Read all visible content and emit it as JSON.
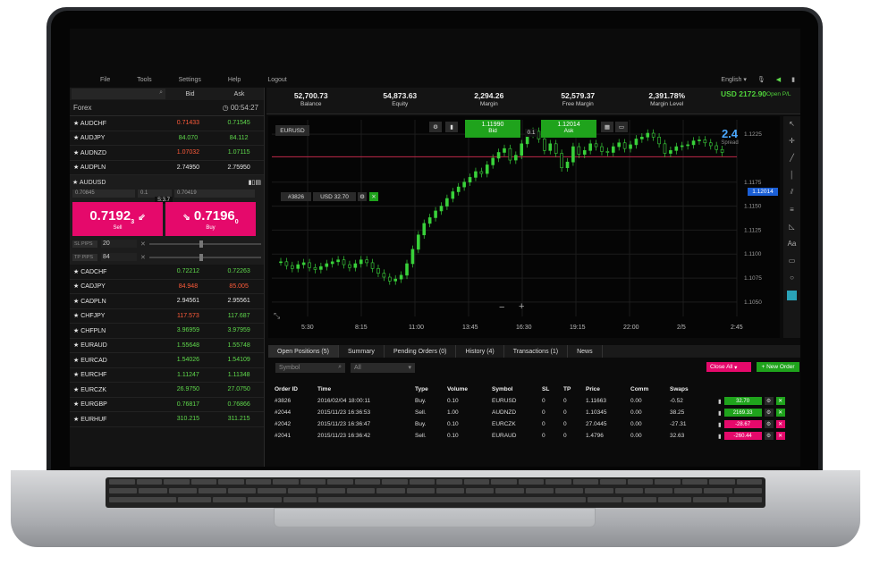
{
  "menu": {
    "items": [
      "File",
      "Tools",
      "Settings",
      "Help",
      "Logout"
    ],
    "language": "English"
  },
  "watchlist": {
    "bid_label": "Bid",
    "ask_label": "Ask",
    "group": "Forex",
    "clock": "00:54:27",
    "rows_top": [
      {
        "sym": "AUDCHF",
        "bid": "0.71433",
        "ask": "0.71545",
        "bc": "red",
        "ac": "green"
      },
      {
        "sym": "AUDJPY",
        "bid": "84.070",
        "ask": "84.112",
        "bc": "green",
        "ac": "green"
      },
      {
        "sym": "AUDNZD",
        "bid": "1.07032",
        "ask": "1.07115",
        "bc": "red",
        "ac": "green"
      },
      {
        "sym": "AUDPLN",
        "bid": "2.74950",
        "ask": "2.75950",
        "bc": "white",
        "ac": "white"
      }
    ],
    "expanded": {
      "sym": "AUDUSD",
      "field1": "0.70845",
      "field2": "0.1",
      "field3": "0.70419",
      "sell_price": "0.7192",
      "sell_sup": "3",
      "sell_label": "Sell",
      "buy_price": "0.7196",
      "buy_sup": "0",
      "buy_label": "Buy",
      "spread": "S:3.7",
      "sl_label": "SL PIPS",
      "sl_value": "20",
      "tp_label": "TP PIPS",
      "tp_value": "84"
    },
    "rows_bottom": [
      {
        "sym": "CADCHF",
        "bid": "0.72212",
        "ask": "0.72263",
        "bc": "green",
        "ac": "green"
      },
      {
        "sym": "CADJPY",
        "bid": "84.948",
        "ask": "85.005",
        "bc": "red",
        "ac": "red"
      },
      {
        "sym": "CADPLN",
        "bid": "2.94561",
        "ask": "2.95561",
        "bc": "white",
        "ac": "white"
      },
      {
        "sym": "CHFJPY",
        "bid": "117.573",
        "ask": "117.687",
        "bc": "red",
        "ac": "green"
      },
      {
        "sym": "CHFPLN",
        "bid": "3.96959",
        "ask": "3.97959",
        "bc": "green",
        "ac": "green"
      },
      {
        "sym": "EURAUD",
        "bid": "1.55648",
        "ask": "1.55748",
        "bc": "green",
        "ac": "green"
      },
      {
        "sym": "EURCAD",
        "bid": "1.54026",
        "ask": "1.54109",
        "bc": "green",
        "ac": "green"
      },
      {
        "sym": "EURCHF",
        "bid": "1.11247",
        "ask": "1.11348",
        "bc": "green",
        "ac": "green"
      },
      {
        "sym": "EURCZK",
        "bid": "26.9750",
        "ask": "27.0750",
        "bc": "green",
        "ac": "green"
      },
      {
        "sym": "EURGBP",
        "bid": "0.76817",
        "ask": "0.76866",
        "bc": "green",
        "ac": "green"
      },
      {
        "sym": "EURHUF",
        "bid": "310.215",
        "ask": "311.215",
        "bc": "green",
        "ac": "green"
      }
    ]
  },
  "stats": [
    {
      "value": "52,700.73",
      "label": "Balance"
    },
    {
      "value": "54,873.63",
      "label": "Equity"
    },
    {
      "value": "2,294.26",
      "label": "Margin"
    },
    {
      "value": "52,579.37",
      "label": "Free Margin"
    },
    {
      "value": "2,391.78%",
      "label": "Margin Level"
    },
    {
      "value": "USD 2172.90",
      "label": "Open P/L"
    }
  ],
  "chart": {
    "symbol": "EURUSD",
    "bid": "1.11990",
    "bid_label": "Bid",
    "ask": "1.12014",
    "ask_label": "Ask",
    "spread_mid": "0.1",
    "spread": "2.4",
    "spread_label": "Spread",
    "current": "1.12014",
    "order_tag": "#3826",
    "order_value": "USD 32.70",
    "y_ticks": [
      "1.1225",
      "1.1175",
      "1.1150",
      "1.1125",
      "1.1100",
      "1.1075",
      "1.1050"
    ],
    "x_ticks": [
      "5:30",
      "8:15",
      "11:00",
      "13:45",
      "16:30",
      "19:15",
      "22:00",
      "2/5",
      "2:45"
    ]
  },
  "chart_data": {
    "type": "candlestick",
    "ylim": [
      1.1035,
      1.124
    ],
    "close": [
      1.1092,
      1.1088,
      1.1085,
      1.1089,
      1.1091,
      1.1086,
      1.1084,
      1.1087,
      1.109,
      1.1092,
      1.1094,
      1.1089,
      1.1086,
      1.109,
      1.1094,
      1.1091,
      1.1085,
      1.108,
      1.1076,
      1.1072,
      1.1074,
      1.1078,
      1.109,
      1.1105,
      1.112,
      1.1132,
      1.1138,
      1.1145,
      1.115,
      1.1158,
      1.1165,
      1.117,
      1.1175,
      1.118,
      1.1186,
      1.1184,
      1.1193,
      1.12,
      1.1206,
      1.121,
      1.1198,
      1.1203,
      1.1215,
      1.1225,
      1.1228,
      1.122,
      1.1208,
      1.1215,
      1.1205,
      1.119,
      1.1196,
      1.1212,
      1.1204,
      1.1208,
      1.1215,
      1.1212,
      1.1207,
      1.1206,
      1.1212,
      1.1216,
      1.121,
      1.1214,
      1.122,
      1.1222,
      1.1226,
      1.1222,
      1.1215,
      1.1205,
      1.1208,
      1.1212,
      1.1213,
      1.1214,
      1.1218,
      1.1219,
      1.1216,
      1.1213,
      1.1209,
      1.1206
    ]
  },
  "bottom": {
    "tabs": [
      "Open Positions (5)",
      "Summary",
      "Pending Orders (0)",
      "History (4)",
      "Transactions (1)",
      "News"
    ],
    "symbol_placeholder": "Symbol",
    "all_placeholder": "All",
    "close_all": "Close All",
    "new_order": "+ New Order",
    "headers": [
      "Order ID",
      "Time",
      "Type",
      "Volume",
      "Symbol",
      "SL",
      "TP",
      "Price",
      "Comm",
      "Swaps"
    ],
    "rows": [
      {
        "id": "#3826",
        "time": "2016/02/04 18:00:11",
        "type": "Buy.",
        "vol": "0.10",
        "sym": "EURUSD",
        "sl": "0",
        "tp": "0",
        "price": "1.11663",
        "comm": "0.00",
        "swaps": "-0.52",
        "pl": "32.70",
        "plc": "g"
      },
      {
        "id": "#2044",
        "time": "2015/11/23 16:36:53",
        "type": "Sell.",
        "vol": "1.00",
        "sym": "AUDNZD",
        "sl": "0",
        "tp": "0",
        "price": "1.10345",
        "comm": "0.00",
        "swaps": "38.25",
        "pl": "2169.33",
        "plc": "g"
      },
      {
        "id": "#2042",
        "time": "2015/11/23 16:36:47",
        "type": "Buy.",
        "vol": "0.10",
        "sym": "EURCZK",
        "sl": "0",
        "tp": "0",
        "price": "27.0445",
        "comm": "0.00",
        "swaps": "-27.31",
        "pl": "-28.67",
        "plc": "r"
      },
      {
        "id": "#2041",
        "time": "2015/11/23 16:36:42",
        "type": "Sell.",
        "vol": "0.10",
        "sym": "EURAUD",
        "sl": "0",
        "tp": "0",
        "price": "1.4796",
        "comm": "0.00",
        "swaps": "32.63",
        "pl": "-260.44",
        "plc": "r"
      }
    ]
  }
}
